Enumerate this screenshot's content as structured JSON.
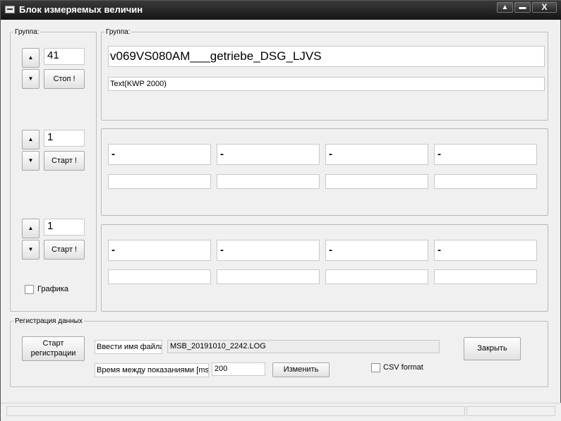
{
  "window": {
    "title": "Блок измеряемых величин"
  },
  "left_panel": {
    "legend": "Группа:",
    "groups": [
      {
        "value": "41",
        "action": "Стоп !"
      },
      {
        "value": "1",
        "action": "Старт  !"
      },
      {
        "value": "1",
        "action": "Старт  !"
      }
    ],
    "graph_checkbox": {
      "label": "Графика",
      "checked": false
    },
    "up_glyph": "▲",
    "down_glyph": "▼"
  },
  "group_info": {
    "legend": "Группа:",
    "name": "v069VS080AM___getriebe_DSG_LJVS",
    "subtitle": "Text(KWP 2000)"
  },
  "blocks": [
    {
      "values": [
        "-",
        "-",
        "-",
        "-"
      ],
      "units": [
        "",
        "",
        "",
        ""
      ]
    },
    {
      "values": [
        "-",
        "-",
        "-",
        "-"
      ],
      "units": [
        "",
        "",
        "",
        ""
      ]
    }
  ],
  "registration": {
    "legend": "Регистрация данных",
    "start_button": "Старт\nрегистрации",
    "filename_label": "Ввести имя файла",
    "filename_value": "MSB_20191010_2242.LOG",
    "interval_label": "Время между показаниями [ms]",
    "interval_value": "200",
    "change_button": "Изменить",
    "csv_label": "CSV format",
    "csv_checked": false,
    "close_button": "Закрыть"
  },
  "status_bar": {
    "left": "",
    "right": ""
  },
  "window_buttons": {
    "minimize": "▲",
    "maximize": "▬",
    "close": "X"
  }
}
